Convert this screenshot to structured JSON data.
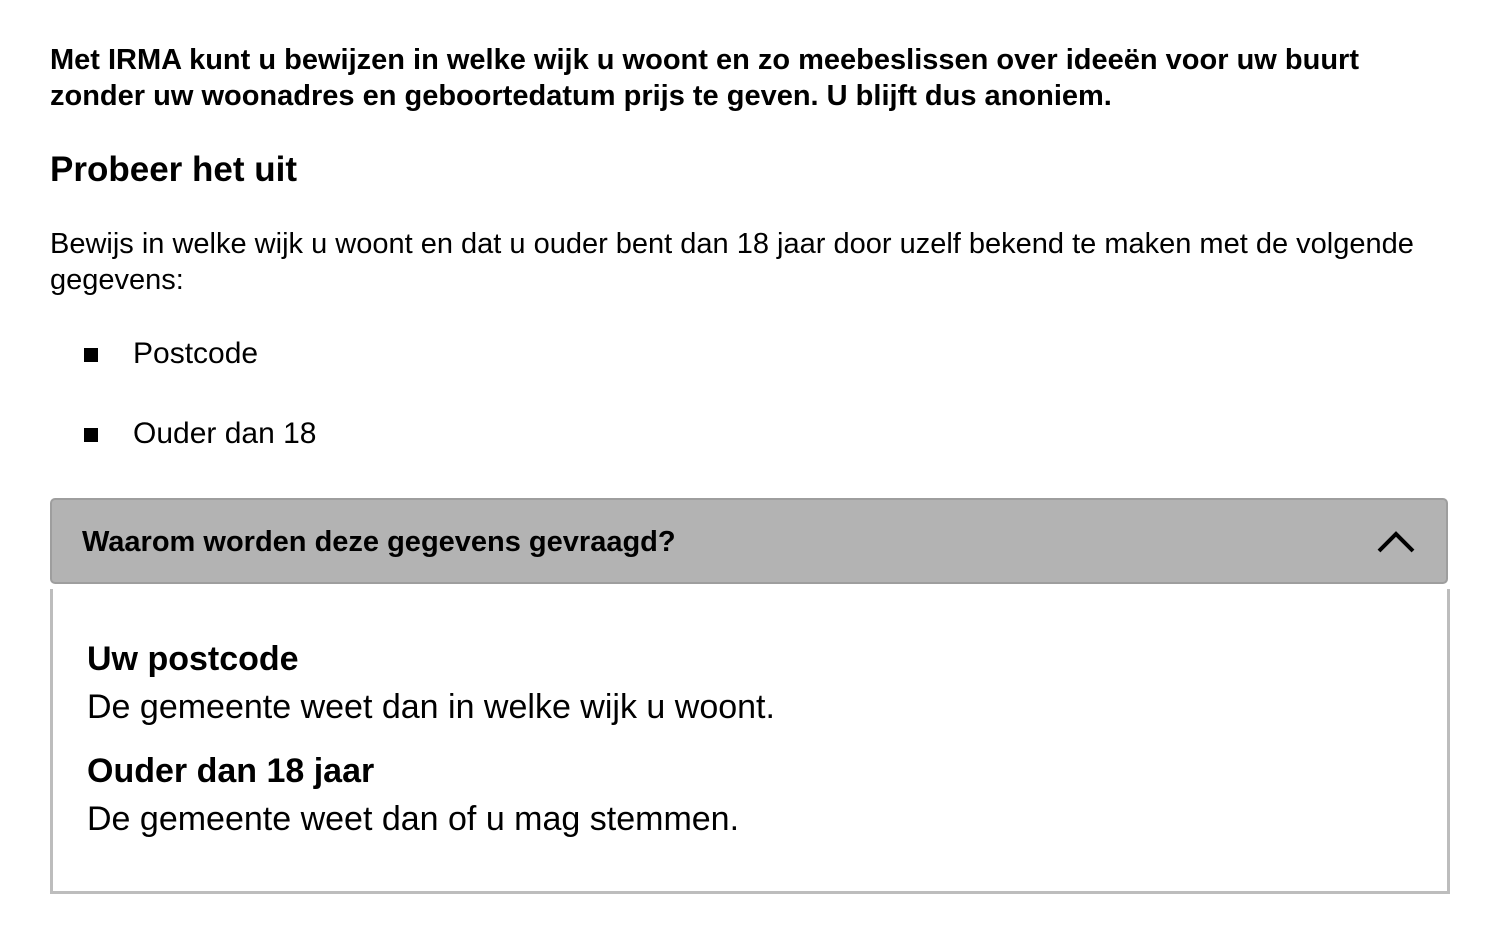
{
  "intro": {
    "text": "Met IRMA kunt u bewijzen in welke wijk u woont en zo meebeslissen over ideeën voor uw buurt zonder uw woonadres en geboortedatum prijs te geven. U blijft dus anoniem."
  },
  "section": {
    "heading": "Probeer het uit",
    "description": "Bewijs in welke wijk u woont en dat u ouder bent dan 18 jaar door uzelf bekend te maken met de volgende gegevens:",
    "attributes": [
      {
        "label": "Postcode"
      },
      {
        "label": "Ouder dan 18"
      }
    ]
  },
  "accordion": {
    "title": "Waarom worden deze gegevens gevraagd?",
    "expanded": true,
    "toggle_icon": "chevron-up-icon",
    "items": [
      {
        "term": "Uw postcode",
        "definition": "De gemeente weet dan in welke wijk u woont."
      },
      {
        "term": "Ouder dan 18 jaar",
        "definition": "De gemeente weet dan of u mag stemmen."
      }
    ]
  },
  "colors": {
    "accordion_header_bg": "#b3b3b3",
    "accordion_border": "#bdbdbd",
    "text": "#000000"
  }
}
